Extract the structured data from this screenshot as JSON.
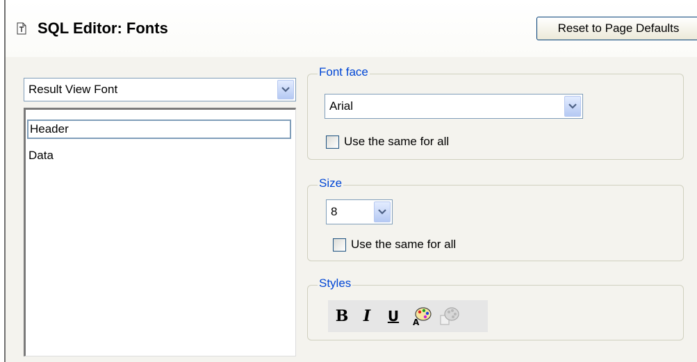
{
  "header": {
    "title": "SQL Editor: Fonts",
    "reset_label": "Reset to Page Defaults"
  },
  "font_selector": {
    "selected": "Result View Font"
  },
  "font_list": {
    "items": [
      "Header",
      "Data"
    ],
    "selected_index": 0
  },
  "font_face": {
    "legend": "Font face",
    "value": "Arial",
    "same_for_all_label": "Use the same for all",
    "same_for_all_checked": false
  },
  "size": {
    "legend": "Size",
    "value": "8",
    "same_for_all_label": "Use the same for all",
    "same_for_all_checked": false
  },
  "styles": {
    "legend": "Styles",
    "bold_label": "B",
    "italic_label": "I",
    "underline_label": "U",
    "tools": [
      "bold-icon",
      "italic-icon",
      "underline-icon",
      "text-color-palette-icon",
      "background-color-palette-icon"
    ]
  },
  "colors": {
    "legend_text": "#0046d5",
    "panel_background": "#f4f3ee",
    "combo_border": "#7f9db9"
  }
}
